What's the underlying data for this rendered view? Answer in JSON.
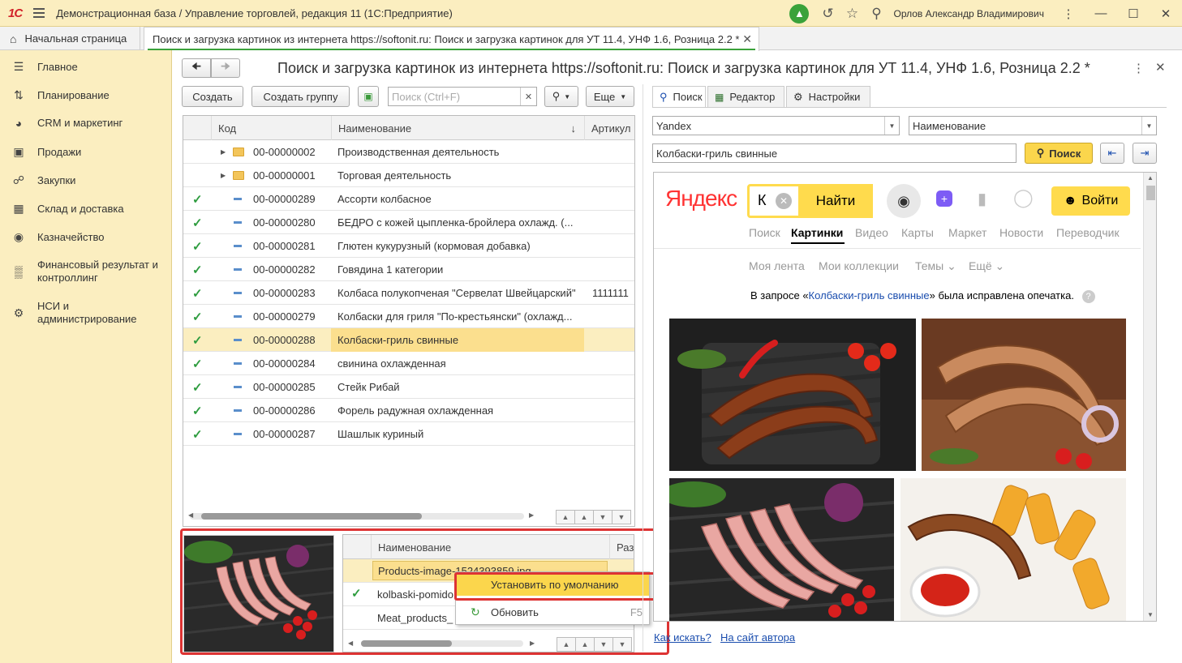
{
  "titlebar": {
    "logo": "1С",
    "title": "Демонстрационная база / Управление торговлей, редакция 11  (1С:Предприятие)",
    "user": "Орлов Александр Владимирович"
  },
  "tabs": {
    "home": "Начальная страница",
    "active": "Поиск и загрузка картинок из интернета https://softonit.ru: Поиск и загрузка картинок для УТ 11.4, УНФ 1.6, Розница 2.2 *"
  },
  "sidebar": [
    {
      "icon": "menu-icon",
      "label": "Главное"
    },
    {
      "icon": "planning-icon",
      "label": "Планирование"
    },
    {
      "icon": "crm-icon",
      "label": "CRM и маркетинг"
    },
    {
      "icon": "bag-icon",
      "label": "Продажи"
    },
    {
      "icon": "cart-icon",
      "label": "Закупки"
    },
    {
      "icon": "warehouse-icon",
      "label": "Склад и доставка"
    },
    {
      "icon": "money-icon",
      "label": "Казначейство"
    },
    {
      "icon": "chart-icon",
      "label": "Финансовый результат и контроллинг"
    },
    {
      "icon": "gear-icon",
      "label": "НСИ и администрирование"
    }
  ],
  "form": {
    "title": "Поиск и загрузка картинок из интернета https://softonit.ru: Поиск и загрузка картинок для УТ 11.4, УНФ 1.6, Розница 2.2 *",
    "create": "Создать",
    "create_group": "Создать группу",
    "search_placeholder": "Поиск (Ctrl+F)",
    "more": "Еще"
  },
  "grid": {
    "columns": [
      "Код",
      "Наименование",
      "Артикул"
    ],
    "rows": [
      {
        "type": "folder",
        "code": "00-00000002",
        "name": "Производственная деятельность",
        "article": ""
      },
      {
        "type": "folder",
        "code": "00-00000001",
        "name": "Торговая деятельность",
        "article": ""
      },
      {
        "type": "item",
        "code": "00-00000289",
        "name": "Ассорти колбасное",
        "article": ""
      },
      {
        "type": "item",
        "code": "00-00000280",
        "name": "БЕДРО с кожей цыпленка-бройлера охлажд. (...",
        "article": ""
      },
      {
        "type": "item",
        "code": "00-00000281",
        "name": "Глютен кукурузный (кормовая добавка)",
        "article": ""
      },
      {
        "type": "item",
        "code": "00-00000282",
        "name": "Говядина 1 категории",
        "article": ""
      },
      {
        "type": "item",
        "code": "00-00000283",
        "name": "Колбаса полукопченая \"Сервелат Швейцарский\"",
        "article": "1111111"
      },
      {
        "type": "item",
        "code": "00-00000279",
        "name": "Колбаски для гриля \"По-крестьянски\" (охлажд...",
        "article": ""
      },
      {
        "type": "item",
        "code": "00-00000288",
        "name": "Колбаски-гриль свинные",
        "article": "",
        "selected": true
      },
      {
        "type": "item",
        "code": "00-00000284",
        "name": "свинина охлажденная",
        "article": ""
      },
      {
        "type": "item",
        "code": "00-00000285",
        "name": "Стейк Рибай",
        "article": ""
      },
      {
        "type": "item",
        "code": "00-00000286",
        "name": "Форель радужная охлажденная",
        "article": ""
      },
      {
        "type": "item",
        "code": "00-00000287",
        "name": "Шашлык куриный",
        "article": ""
      }
    ]
  },
  "files": {
    "columns": [
      "Наименование",
      "Раз"
    ],
    "rows": [
      "Products-image-1524393859.jpg",
      "kolbaski-pomido",
      "Meat_products_"
    ]
  },
  "context_menu": {
    "set_default": "Установить по умолчанию",
    "refresh": "Обновить",
    "refresh_key": "F5"
  },
  "right": {
    "tabs": [
      "Поиск",
      "Редактор",
      "Настройки"
    ],
    "engine": "Yandex",
    "field": "Наименование",
    "query": "Колбаски-гриль свинные",
    "search_btn": "Поиск",
    "links": [
      "Как искать?",
      "На сайт автора"
    ]
  },
  "yandex": {
    "logo": "Яндекс",
    "input_value": "К",
    "find": "Найти",
    "login": "Войти",
    "nav": [
      "Поиск",
      "Картинки",
      "Видео",
      "Карты",
      "Маркет",
      "Новости",
      "Переводчик"
    ],
    "subnav": [
      "Моя лента",
      "Мои коллекции",
      "Темы",
      "Ещё"
    ],
    "fix_prefix": "В запросе «",
    "fix_query": "Колбаски-гриль свинные",
    "fix_suffix": "» была исправлена опечатка."
  },
  "colors": {
    "accent": "#fbeec0",
    "selected": "#fbdf8e",
    "check": "#2e9c3f",
    "yandex_btn": "#ffdb4d",
    "highlight": "#d33333"
  }
}
